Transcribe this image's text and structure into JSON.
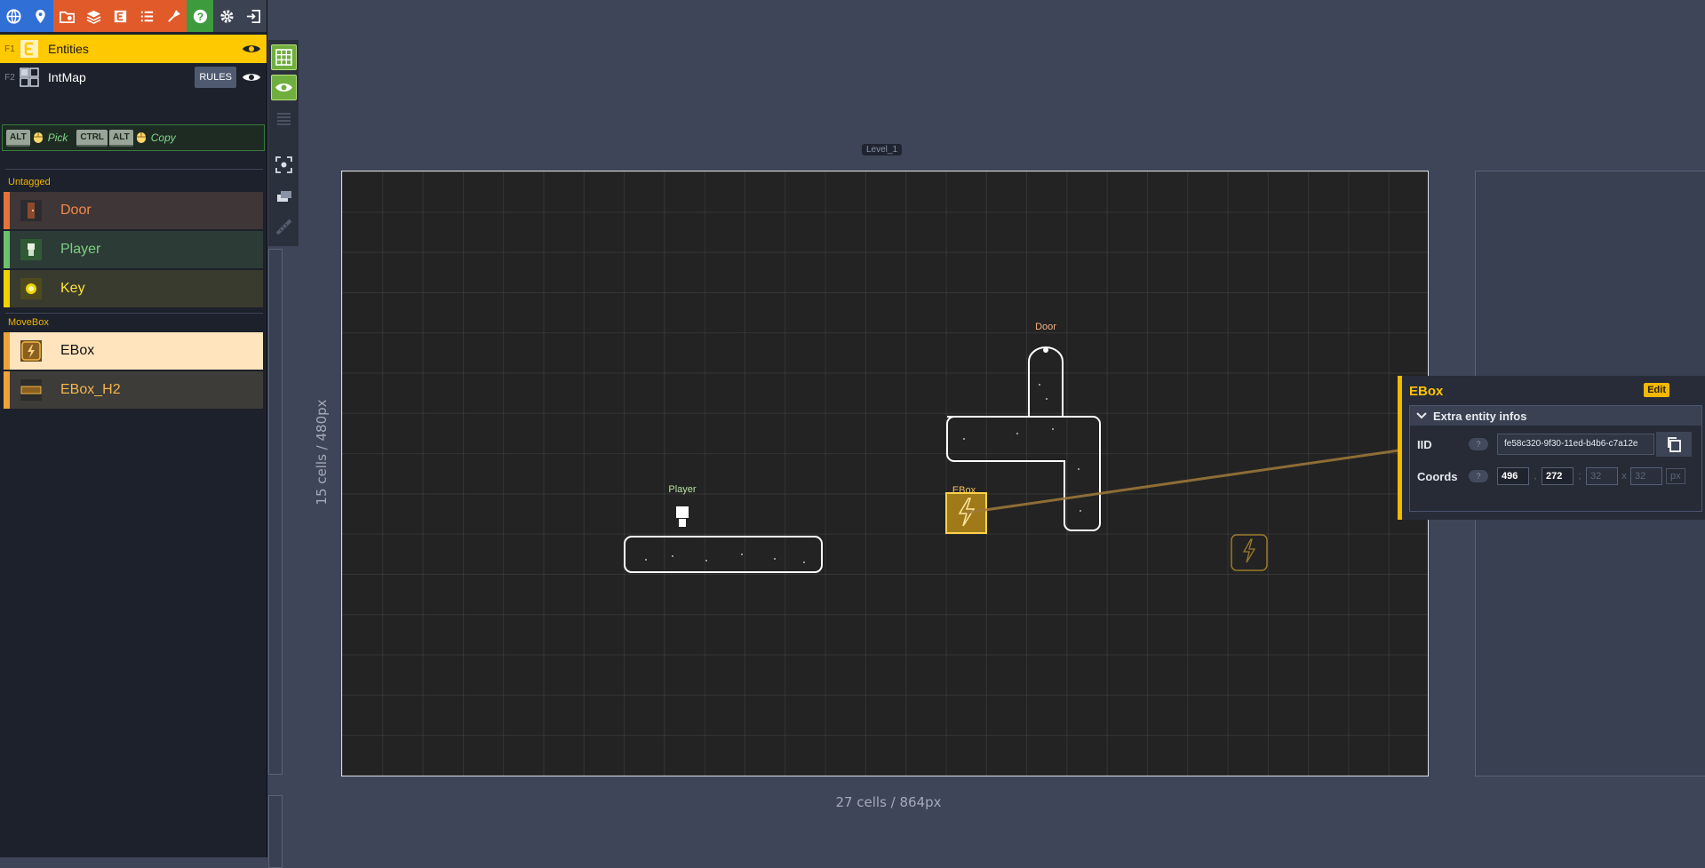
{
  "toolbar": {
    "buttons": [
      {
        "icon": "globe-icon",
        "color": "#2f6fd6"
      },
      {
        "icon": "map-pin-icon",
        "color": "#2f6fd6"
      },
      {
        "icon": "project-settings-icon",
        "color": "#e05a2a"
      },
      {
        "icon": "layers-icon",
        "color": "#e05a2a"
      },
      {
        "icon": "entity-icon",
        "color": "#e05a2a"
      },
      {
        "icon": "enum-list-icon",
        "color": "#e05a2a"
      },
      {
        "icon": "tilesets-icon",
        "color": "#e05a2a"
      },
      {
        "icon": "help-icon",
        "color": "#3d9b3d"
      },
      {
        "icon": "gear-icon",
        "color": "#3b4252"
      },
      {
        "icon": "exit-icon",
        "color": "#3b4252"
      }
    ]
  },
  "layers": [
    {
      "fkey": "F1",
      "name": "Entities",
      "active": true
    },
    {
      "fkey": "F2",
      "name": "IntMap",
      "rules_label": "RULES",
      "active": false
    }
  ],
  "shortcuts": {
    "pick_keys": [
      "ALT"
    ],
    "pick_label": "Pick",
    "copy_keys": [
      "CTRL",
      "ALT"
    ],
    "copy_label": "Copy"
  },
  "entity_groups": [
    {
      "tag": "Untagged",
      "entities": [
        {
          "name": "Door",
          "color": "#e8733a"
        },
        {
          "name": "Player",
          "color": "#6cc26c"
        },
        {
          "name": "Key",
          "color": "#f2d300"
        }
      ]
    },
    {
      "tag": "MoveBox",
      "entities": [
        {
          "name": "EBox",
          "color": "#f0a23a",
          "selected": true
        },
        {
          "name": "EBox_H2",
          "color": "#f0a23a"
        }
      ]
    }
  ],
  "level": {
    "name": "Level_1",
    "width_label": "27 cells / 864px",
    "height_label": "15 cells / 480px",
    "entity_labels": {
      "door": "Door",
      "player": "Player",
      "ebox": "EBox"
    }
  },
  "inspector": {
    "title": "EBox",
    "edit_label": "Edit",
    "section_label": "Extra entity infos",
    "iid_label": "IID",
    "iid_value": "fe58c320-9f30-11ed-b4b6-c7a12e",
    "coords_label": "Coords",
    "help_mark": "?",
    "x": "496",
    "y": "272",
    "w": "32",
    "h": "32",
    "unit": "px"
  }
}
